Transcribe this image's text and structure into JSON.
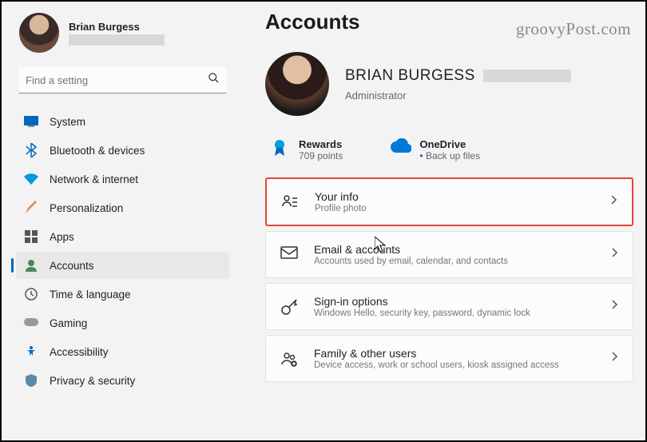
{
  "watermark": "groovyPost.com",
  "user": {
    "name": "Brian Burgess"
  },
  "search": {
    "placeholder": "Find a setting"
  },
  "sidebar": {
    "items": [
      {
        "label": "System"
      },
      {
        "label": "Bluetooth & devices"
      },
      {
        "label": "Network & internet"
      },
      {
        "label": "Personalization"
      },
      {
        "label": "Apps"
      },
      {
        "label": "Accounts"
      },
      {
        "label": "Time & language"
      },
      {
        "label": "Gaming"
      },
      {
        "label": "Accessibility"
      },
      {
        "label": "Privacy & security"
      }
    ]
  },
  "page": {
    "title": "Accounts"
  },
  "account": {
    "name": "BRIAN BURGESS",
    "role": "Administrator"
  },
  "stats": {
    "rewards": {
      "title": "Rewards",
      "sub": "709 points"
    },
    "onedrive": {
      "title": "OneDrive",
      "sub": "Back up files"
    }
  },
  "cards": {
    "yourinfo": {
      "title": "Your info",
      "sub": "Profile photo"
    },
    "email": {
      "title": "Email & accounts",
      "sub": "Accounts used by email, calendar, and contacts"
    },
    "signin": {
      "title": "Sign-in options",
      "sub": "Windows Hello, security key, password, dynamic lock"
    },
    "family": {
      "title": "Family & other users",
      "sub": "Device access, work or school users, kiosk assigned access"
    }
  }
}
